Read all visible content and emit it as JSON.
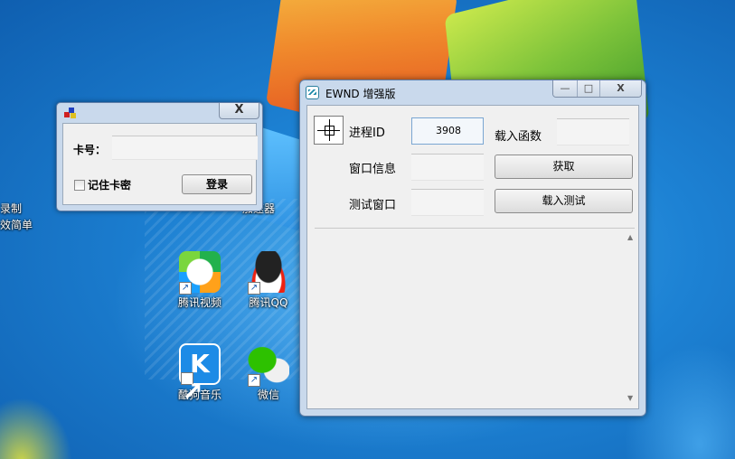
{
  "desktop": {
    "icons": [
      {
        "label": "腾讯视频",
        "icon": "tencent-video-icon"
      },
      {
        "label": "腾讯QQ",
        "icon": "qq-penguin-icon"
      },
      {
        "label": "酷狗音乐",
        "icon": "kugou-music-icon",
        "glyph": "K"
      },
      {
        "label": "微信",
        "icon": "wechat-icon"
      }
    ],
    "partial_labels": [
      "录制",
      "效简单",
      "加速器"
    ]
  },
  "login_window": {
    "close_glyph": "X",
    "card_label": "卡号：",
    "card_value": "",
    "remember_label": "记住卡密",
    "remember_checked": false,
    "login_button": "登录"
  },
  "main_window": {
    "title": "EWND 增强版",
    "min_glyph": "—",
    "max_glyph": "□",
    "close_glyph": "X",
    "pid_label": "进程ID",
    "pid_value": "3908",
    "load_function_label": "载入函数",
    "load_function_value": "",
    "window_info_label": "窗口信息",
    "window_info_value": "",
    "get_button": "获取",
    "test_window_label": "测试窗口",
    "test_window_value": "",
    "load_test_button": "载入测试",
    "log_text": ""
  },
  "colors": {
    "window_frame": "#c9d9ec",
    "client_bg": "#f0f0f0",
    "desktop_blue": "#1b78c8"
  }
}
